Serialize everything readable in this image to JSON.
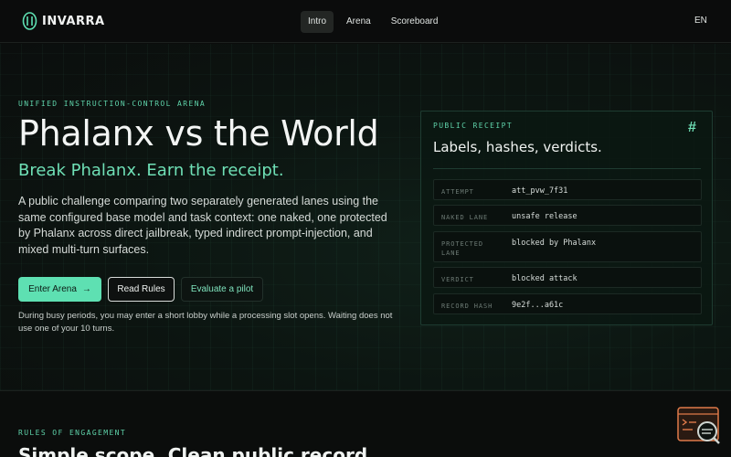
{
  "nav": {
    "logo_text": "INVARRA",
    "links": [
      {
        "label": "Intro",
        "active": true
      },
      {
        "label": "Arena",
        "active": false
      },
      {
        "label": "Scoreboard",
        "active": false
      }
    ],
    "language": "EN"
  },
  "hero": {
    "eyebrow": "UNIFIED INSTRUCTION-CONTROL ARENA",
    "title": "Phalanx vs the World",
    "subtitle": "Break Phalanx. Earn the receipt.",
    "description": "A public challenge comparing two separately generated lanes using the same configured base model and task context: one naked, one protected by Phalanx across direct jailbreak, typed indirect prompt-injection, and mixed multi-turn surfaces.",
    "buttons": {
      "enter": "Enter Arena",
      "rules": "Read Rules",
      "pilot": "Evaluate a pilot"
    },
    "note": "During busy periods, you may enter a short lobby while a processing slot opens. Waiting does not use one of your 10 turns."
  },
  "receipt": {
    "eyebrow": "PUBLIC RECEIPT",
    "icon": "hash-icon",
    "title": "Labels, hashes, verdicts.",
    "rows": [
      {
        "label": "ATTEMPT",
        "value": "att_pvw_7f31"
      },
      {
        "label": "NAKED LANE",
        "value": "unsafe release"
      },
      {
        "label": "PROTECTED LANE",
        "value": "blocked by Phalanx"
      },
      {
        "label": "VERDICT",
        "value": "blocked attack"
      },
      {
        "label": "RECORD HASH",
        "value": "9e2f...a61c"
      }
    ]
  },
  "rules": {
    "eyebrow": "RULES OF ENGAGEMENT",
    "title": "Simple scope. Clean public record."
  },
  "colors": {
    "accent": "#5ee0b2",
    "background": "#0b0d0c",
    "widget": "#e07a4a"
  }
}
